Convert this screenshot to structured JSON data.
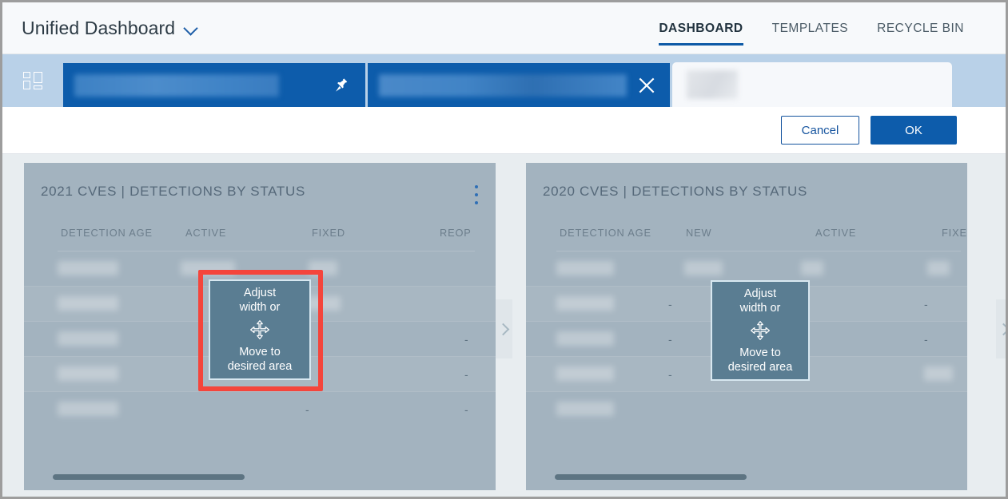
{
  "header": {
    "title": "Unified Dashboard",
    "dropdown_icon": "chevron-down-icon",
    "nav_tabs": [
      {
        "label": "DASHBOARD",
        "active": true
      },
      {
        "label": "TEMPLATES",
        "active": false
      },
      {
        "label": "RECYCLE BIN",
        "active": false
      }
    ]
  },
  "toolbar": {
    "layout_icon": "dashboard-grid-icon",
    "tabs": [
      {
        "id": "tab-pinned",
        "label": "",
        "state": "active",
        "action_icon": "pin-icon"
      },
      {
        "id": "tab-close",
        "label": "",
        "state": "active",
        "action_icon": "close-icon"
      },
      {
        "id": "tab-inactive",
        "label": "",
        "state": "inactive",
        "action_icon": ""
      }
    ]
  },
  "action_bar": {
    "cancel_label": "Cancel",
    "ok_label": "OK"
  },
  "colors": {
    "accent_blue": "#0d5cab",
    "toolbar_blue": "#b9d1e8",
    "widget_overlay": "#a3b3bf",
    "hint_bg": "#5a7d92",
    "highlight_red": "#f4453c",
    "scrollbar_thumb": "#5d7482"
  },
  "widgets": [
    {
      "id": "widget-2021",
      "title": "2021 CVES | DETECTIONS BY STATUS",
      "menu_icon": "kebab-menu-icon",
      "columns": [
        "DETECTION AGE",
        "ACTIVE",
        "FIXED",
        "REOP"
      ],
      "rows": [
        {
          "cells": [
            "",
            "",
            "",
            ""
          ]
        },
        {
          "cells": [
            "",
            "",
            "",
            ""
          ]
        },
        {
          "cells": [
            "",
            "",
            "-",
            "-"
          ]
        },
        {
          "cells": [
            "",
            "",
            "-",
            "-"
          ]
        },
        {
          "cells": [
            "",
            "",
            "-",
            "-"
          ]
        }
      ],
      "scrollbar": {
        "thumb_label": "horizontal-scrollbar"
      }
    },
    {
      "id": "widget-2020",
      "title": "2020 CVES | DETECTIONS BY STATUS",
      "menu_icon": "",
      "columns": [
        "DETECTION AGE",
        "NEW",
        "ACTIVE",
        "FIXE"
      ],
      "rows": [
        {
          "cells": [
            "",
            "",
            "",
            ""
          ]
        },
        {
          "cells": [
            "",
            "-",
            "",
            "-"
          ]
        },
        {
          "cells": [
            "",
            "-",
            "",
            "-"
          ]
        },
        {
          "cells": [
            "",
            "-",
            "-",
            ""
          ]
        },
        {
          "cells": [
            "",
            "",
            "",
            ""
          ]
        }
      ],
      "scrollbar": {
        "thumb_label": "horizontal-scrollbar"
      }
    }
  ],
  "drag_hints": [
    {
      "id": "hint-left",
      "line1": "Adjust\nwidth or",
      "icon": "move-arrows-icon",
      "line2": "Move to\ndesired area",
      "highlighted": true
    },
    {
      "id": "hint-right",
      "line1": "Adjust\nwidth or",
      "icon": "move-arrows-icon",
      "line2": "Move to\ndesired area",
      "highlighted": false
    }
  ],
  "carousel": {
    "next_icon": "chevron-right-icon"
  }
}
